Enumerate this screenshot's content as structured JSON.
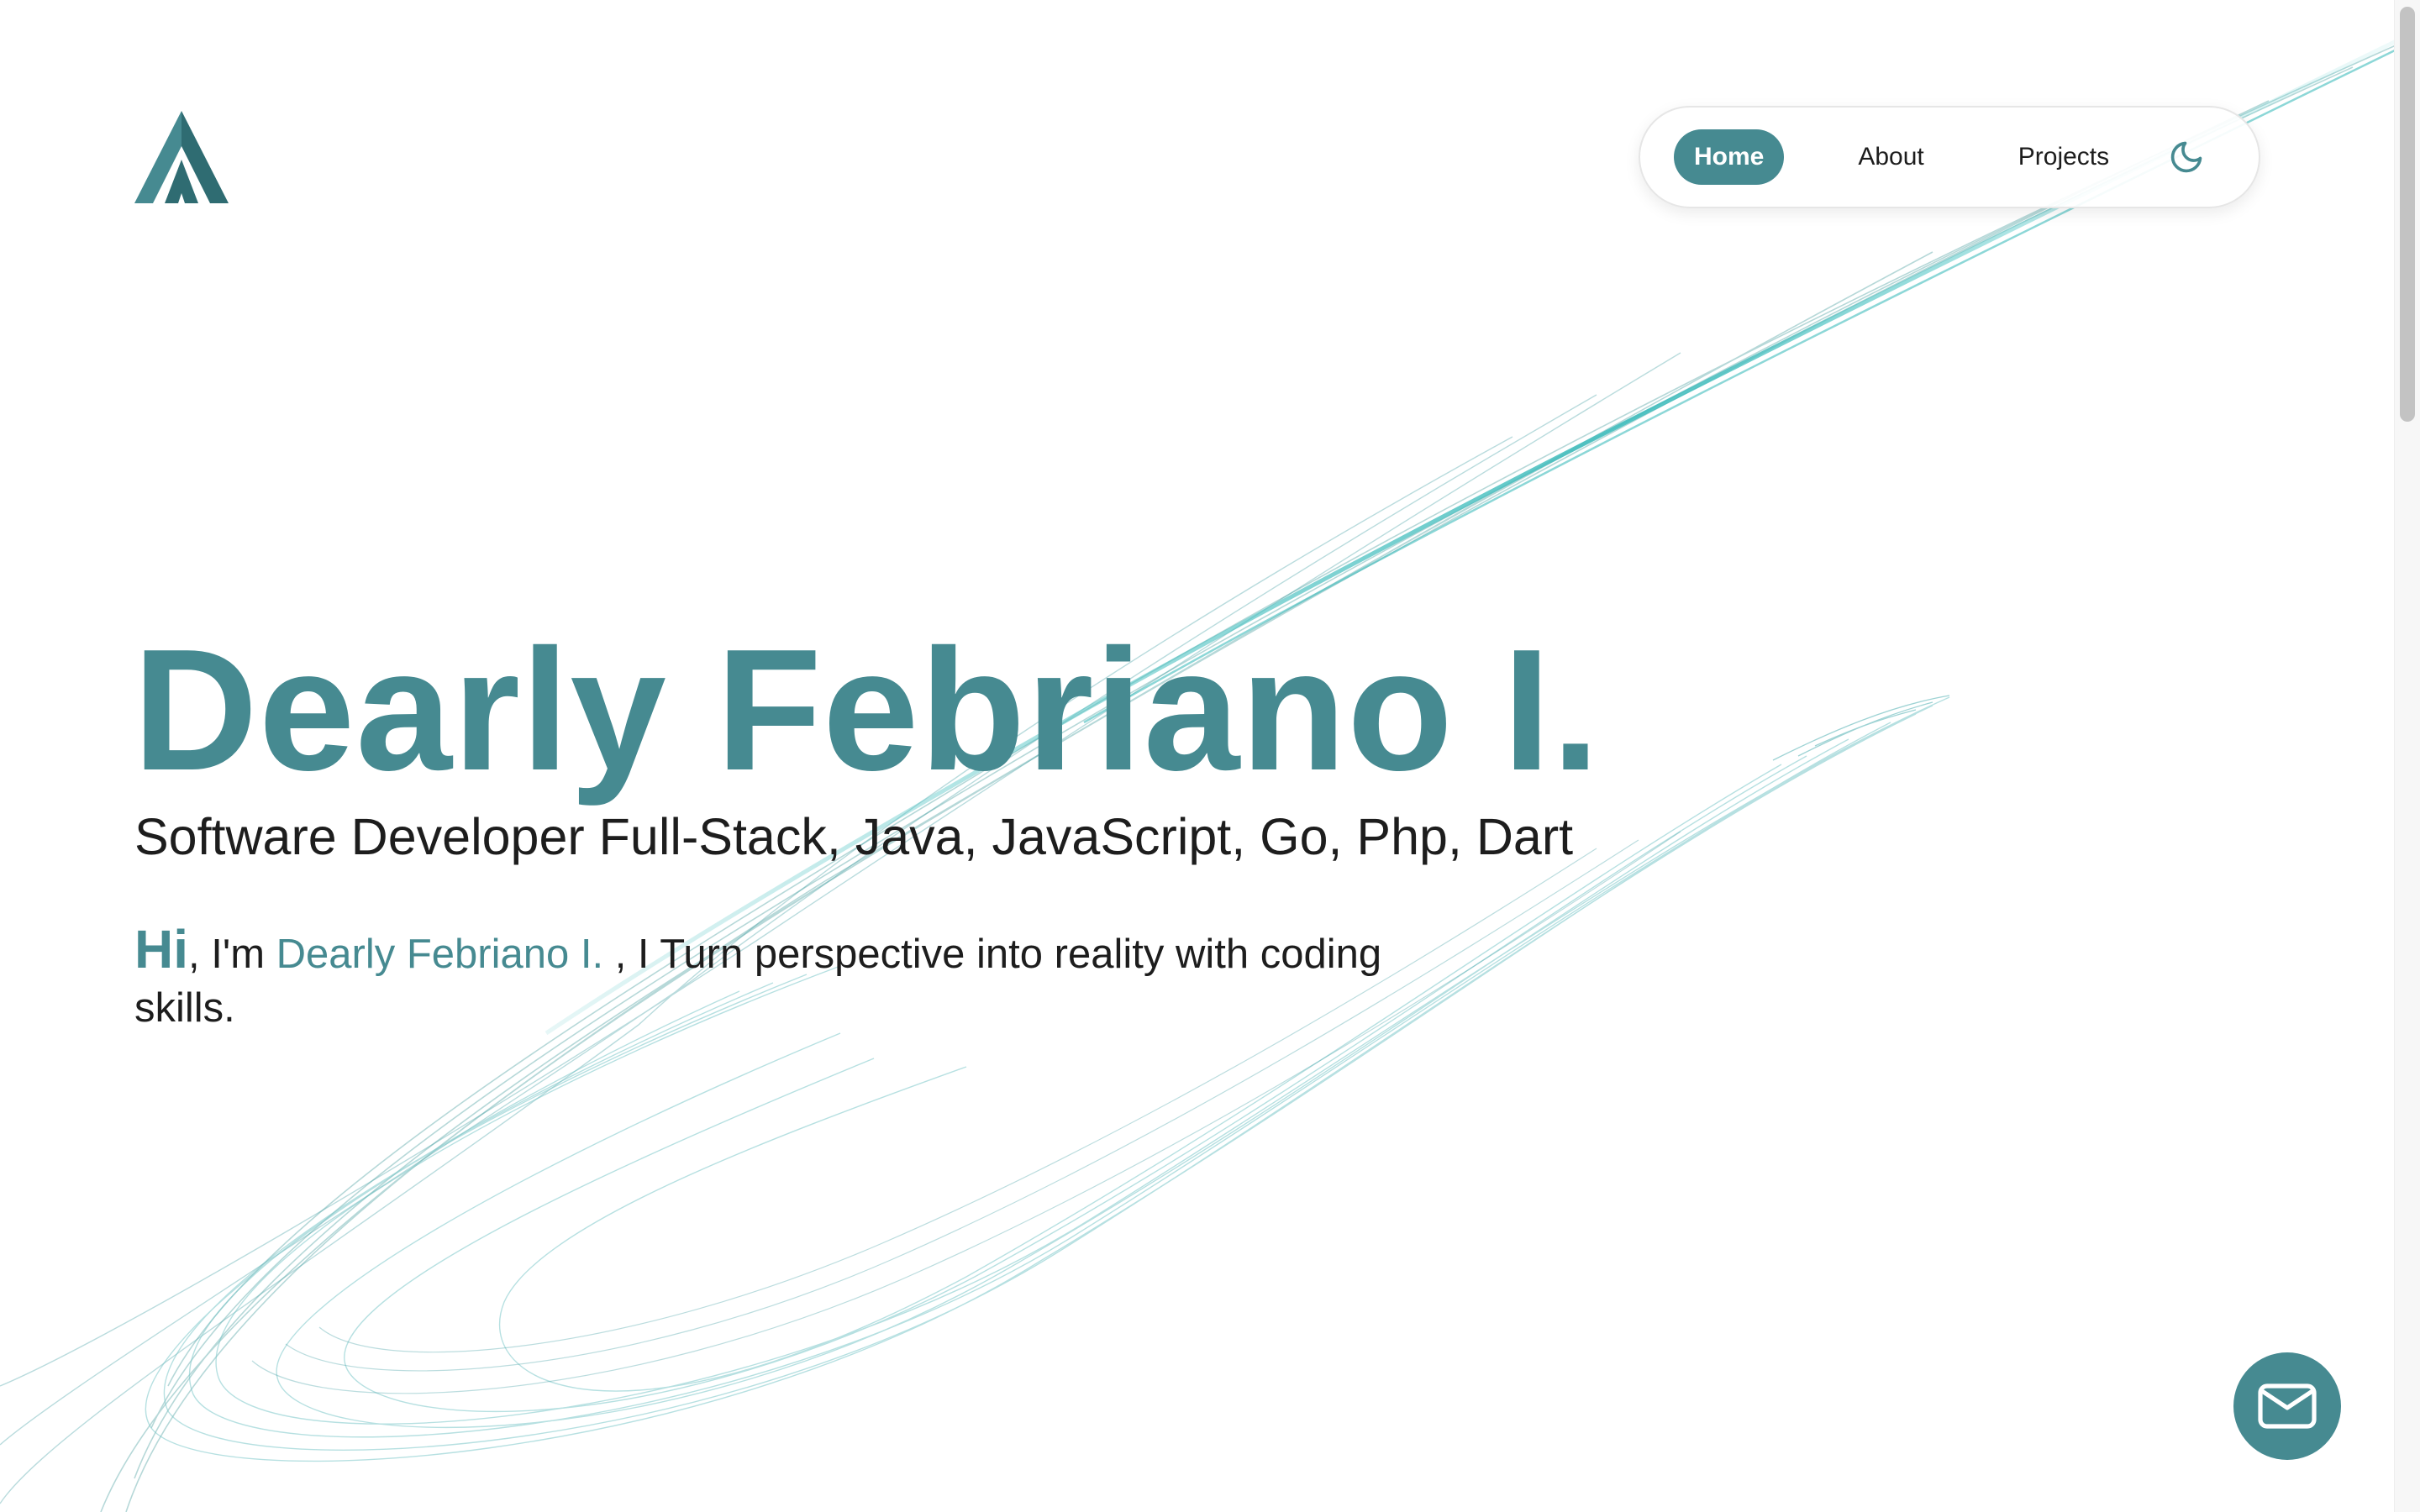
{
  "brand": {
    "logo_icon": "stylized-a-logo-icon",
    "accent": "#468a91"
  },
  "nav": {
    "items": [
      {
        "label": "Home",
        "active": true
      },
      {
        "label": "About",
        "active": false
      },
      {
        "label": "Projects",
        "active": false
      }
    ],
    "theme_icon": "moon-icon"
  },
  "hero": {
    "title": "Dearly Febriano I.",
    "subtitle": "Software Developer Full-Stack, Java, JavaScript, Go, Php, Dart",
    "intro": {
      "hi": "Hi",
      "text1": ", I'm ",
      "name": "Dearly Febriano I. ",
      "text2": ", I Turn perspective into reality with coding skills."
    }
  },
  "contact": {
    "icon": "mail-icon"
  },
  "colors": {
    "text": "#1d1d1d",
    "swirl": "#5ec9c9"
  }
}
